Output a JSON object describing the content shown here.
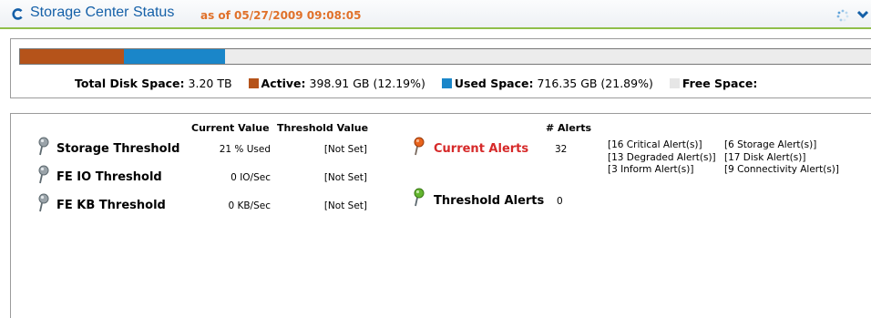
{
  "header": {
    "title": "Storage Center Status",
    "timestamp": "as of 05/27/2009 09:08:05"
  },
  "disk": {
    "total_label": "Total Disk Space:",
    "total_value": "3.20 TB",
    "active_label": "Active:",
    "active_value": "398.91 GB (12.19%)",
    "active_fraction": 0.1219,
    "used_label": "Used Space:",
    "used_value": "716.35 GB (21.89%)",
    "used_fraction": 0.1189,
    "free_label": "Free Space:",
    "colors": {
      "active": "#b5531a",
      "used": "#1a86c9",
      "free": "#e6e6e6"
    }
  },
  "thresholds": {
    "col_current": "Current Value",
    "col_threshold": "Threshold Value",
    "rows": [
      {
        "name": "Storage Threshold",
        "current": "21 % Used",
        "threshold": "[Not Set]",
        "icon": "pin-gray-icon"
      },
      {
        "name": "FE IO Threshold",
        "current": "0 IO/Sec",
        "threshold": "[Not Set]",
        "icon": "pin-gray-icon"
      },
      {
        "name": "FE KB Threshold",
        "current": "0 KB/Sec",
        "threshold": "[Not Set]",
        "icon": "pin-gray-icon"
      }
    ]
  },
  "alerts": {
    "col_count": "# Alerts",
    "current": {
      "name": "Current Alerts",
      "count": "32",
      "icon": "pin-orange-icon",
      "left": [
        "[16 Critical Alert(s)]",
        "[13 Degraded Alert(s)]",
        "[3 Inform Alert(s)]"
      ],
      "right": [
        "[6 Storage Alert(s)]",
        "[17 Disk Alert(s)]",
        "[9 Connectivity Alert(s)]"
      ]
    },
    "threshold": {
      "name": "Threshold Alerts",
      "count": "0",
      "icon": "pin-green-icon"
    }
  }
}
